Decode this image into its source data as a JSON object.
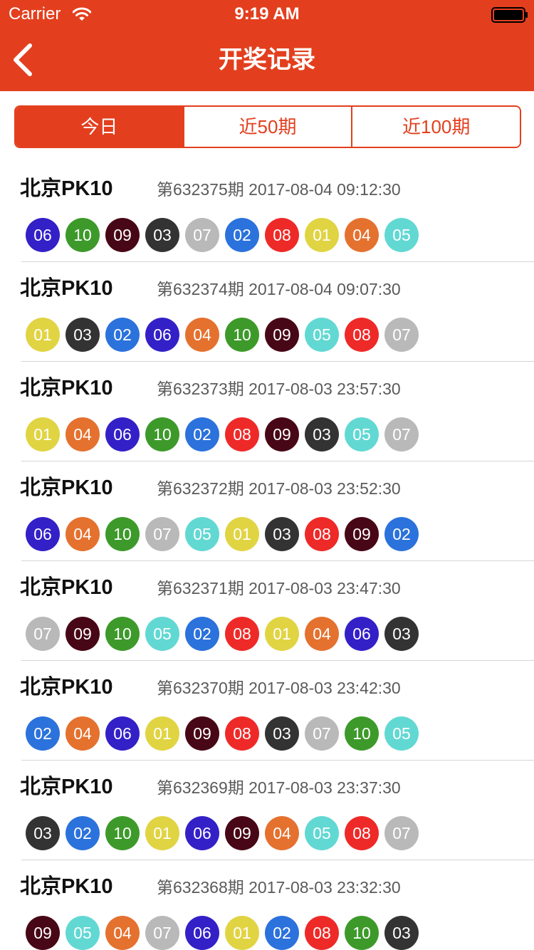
{
  "status_bar": {
    "carrier": "Carrier",
    "time": "9:19 AM"
  },
  "nav": {
    "title": "开奖记录",
    "back_icon": "chevron-left-icon"
  },
  "tabs": [
    {
      "label": "今日",
      "active": true
    },
    {
      "label": "近50期",
      "active": false
    },
    {
      "label": "近100期",
      "active": false
    }
  ],
  "colors": {
    "accent": "#e33f1e",
    "ball_colors": {
      "01": "#e1d443",
      "02": "#2b72dc",
      "03": "#333333",
      "04": "#e5712f",
      "05": "#62d8d3",
      "06": "#3320c7",
      "07": "#b9b9b9",
      "08": "#ee2a28",
      "09": "#480716",
      "10": "#3d9a2a"
    }
  },
  "records": [
    {
      "name": "北京PK10",
      "issue": "第632375期 2017-08-04 09:12:30",
      "numbers": [
        "06",
        "10",
        "09",
        "03",
        "07",
        "02",
        "08",
        "01",
        "04",
        "05"
      ]
    },
    {
      "name": "北京PK10",
      "issue": "第632374期 2017-08-04 09:07:30",
      "numbers": [
        "01",
        "03",
        "02",
        "06",
        "04",
        "10",
        "09",
        "05",
        "08",
        "07"
      ]
    },
    {
      "name": "北京PK10",
      "issue": "第632373期 2017-08-03 23:57:30",
      "numbers": [
        "01",
        "04",
        "06",
        "10",
        "02",
        "08",
        "09",
        "03",
        "05",
        "07"
      ]
    },
    {
      "name": "北京PK10",
      "issue": "第632372期 2017-08-03 23:52:30",
      "numbers": [
        "06",
        "04",
        "10",
        "07",
        "05",
        "01",
        "03",
        "08",
        "09",
        "02"
      ]
    },
    {
      "name": "北京PK10",
      "issue": "第632371期 2017-08-03 23:47:30",
      "numbers": [
        "07",
        "09",
        "10",
        "05",
        "02",
        "08",
        "01",
        "04",
        "06",
        "03"
      ]
    },
    {
      "name": "北京PK10",
      "issue": "第632370期 2017-08-03 23:42:30",
      "numbers": [
        "02",
        "04",
        "06",
        "01",
        "09",
        "08",
        "03",
        "07",
        "10",
        "05"
      ]
    },
    {
      "name": "北京PK10",
      "issue": "第632369期 2017-08-03 23:37:30",
      "numbers": [
        "03",
        "02",
        "10",
        "01",
        "06",
        "09",
        "04",
        "05",
        "08",
        "07"
      ]
    },
    {
      "name": "北京PK10",
      "issue": "第632368期 2017-08-03 23:32:30",
      "numbers": [
        "09",
        "05",
        "04",
        "07",
        "06",
        "01",
        "02",
        "08",
        "10",
        "03"
      ]
    }
  ]
}
